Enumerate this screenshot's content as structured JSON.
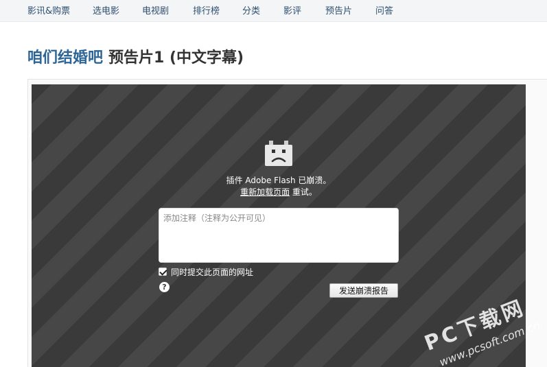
{
  "nav": {
    "items": [
      {
        "label": "影讯&购票"
      },
      {
        "label": "选电影"
      },
      {
        "label": "电视剧"
      },
      {
        "label": "排行榜"
      },
      {
        "label": "分类"
      },
      {
        "label": "影评"
      },
      {
        "label": "预告片"
      },
      {
        "label": "问答"
      }
    ]
  },
  "page": {
    "movie_title": "咱们结婚吧",
    "clip_title": "预告片1 (中文字幕)"
  },
  "player": {
    "crash_message": "插件 Adobe Flash 已崩溃。",
    "reload_link": "重新加载页面",
    "reload_suffix": " 重试。",
    "comment_placeholder": "添加注释（注释为公开可见）",
    "include_url_label": "同时提交此页面的网址",
    "include_url_checked": true,
    "help_symbol": "?",
    "send_button": "发送崩溃报告"
  },
  "watermark": {
    "brand": "PC下载网",
    "url": "www.pcsoft.com.cn"
  },
  "colors": {
    "nav_bg": "#f4f5f7",
    "nav_link": "#2d4f6e",
    "movie_title": "#2c6596",
    "clip_title": "#333333",
    "player_stripe_dark": "#3a3a3a",
    "player_stripe_light": "#474747"
  }
}
